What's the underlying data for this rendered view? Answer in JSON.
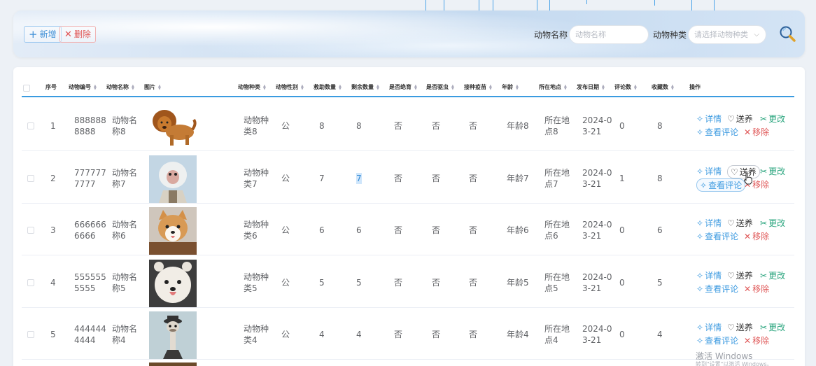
{
  "toolbar": {
    "add_label": "新增",
    "delete_label": "删除",
    "name_label": "动物名称",
    "name_placeholder": "动物名称",
    "type_label": "动物种类",
    "type_placeholder": "请选择动物种类"
  },
  "table": {
    "headers": [
      "序号",
      "动物编号",
      "动物名称",
      "图片",
      "动物种类",
      "动物性别",
      "救助数量",
      "剩余数量",
      "是否绝育",
      "是否驱虫",
      "接种疫苗",
      "年龄",
      "所在地点",
      "发布日期",
      "评论数",
      "收藏数",
      "操作"
    ],
    "actions": {
      "detail": "详情",
      "adopt": "送养",
      "edit": "更改",
      "comments": "查看评论",
      "remove": "移除"
    },
    "rows": [
      {
        "index": "1",
        "code_l1": "888888",
        "code_l2": "8888",
        "name_l1": "动物名",
        "name_l2": "称8",
        "type_l1": "动物种",
        "type_l2": "类8",
        "gender": "公",
        "rescue": "8",
        "remain": "8",
        "neutered": "否",
        "dewormed": "否",
        "vaccine": "否",
        "age": "年龄8",
        "loc_l1": "所在地",
        "loc_l2": "点8",
        "date_l1": "2024-0",
        "date_l2": "3-21",
        "comments": "0",
        "favs": "8",
        "image": "lion-dog"
      },
      {
        "index": "2",
        "code_l1": "777777",
        "code_l2": "7777",
        "name_l1": "动物名",
        "name_l2": "称7",
        "type_l1": "动物种",
        "type_l2": "类7",
        "gender": "公",
        "rescue": "7",
        "remain": "7",
        "neutered": "否",
        "dewormed": "否",
        "vaccine": "否",
        "age": "年龄7",
        "loc_l1": "所在地",
        "loc_l2": "点7",
        "date_l1": "2024-0",
        "date_l2": "3-21",
        "comments": "1",
        "favs": "8",
        "image": "monkey"
      },
      {
        "index": "3",
        "code_l1": "666666",
        "code_l2": "6666",
        "name_l1": "动物名",
        "name_l2": "称6",
        "type_l1": "动物种",
        "type_l2": "类6",
        "gender": "公",
        "rescue": "6",
        "remain": "6",
        "neutered": "否",
        "dewormed": "否",
        "vaccine": "否",
        "age": "年龄6",
        "loc_l1": "所在地",
        "loc_l2": "点6",
        "date_l1": "2024-0",
        "date_l2": "3-21",
        "comments": "0",
        "favs": "6",
        "image": "corgi"
      },
      {
        "index": "4",
        "code_l1": "555555",
        "code_l2": "5555",
        "name_l1": "动物名",
        "name_l2": "称5",
        "type_l1": "动物种",
        "type_l2": "类5",
        "gender": "公",
        "rescue": "5",
        "remain": "5",
        "neutered": "否",
        "dewormed": "否",
        "vaccine": "否",
        "age": "年龄5",
        "loc_l1": "所在地",
        "loc_l2": "点5",
        "date_l1": "2024-0",
        "date_l2": "3-21",
        "comments": "0",
        "favs": "5",
        "image": "white-dog"
      },
      {
        "index": "5",
        "code_l1": "444444",
        "code_l2": "4444",
        "name_l1": "动物名",
        "name_l2": "称4",
        "type_l1": "动物种",
        "type_l2": "类4",
        "gender": "公",
        "rescue": "4",
        "remain": "4",
        "neutered": "否",
        "dewormed": "否",
        "vaccine": "否",
        "age": "年龄4",
        "loc_l1": "所在地",
        "loc_l2": "点4",
        "date_l1": "2024-0",
        "date_l2": "3-21",
        "comments": "0",
        "favs": "4",
        "image": "ostrich"
      }
    ]
  },
  "watermark": {
    "line1": "激活 Windows",
    "line2": "转到\"设置\"以激活 Windows。"
  },
  "colors": {
    "accent": "#3a9be0",
    "edit": "#2aa57e",
    "danger": "#e05a5a"
  }
}
